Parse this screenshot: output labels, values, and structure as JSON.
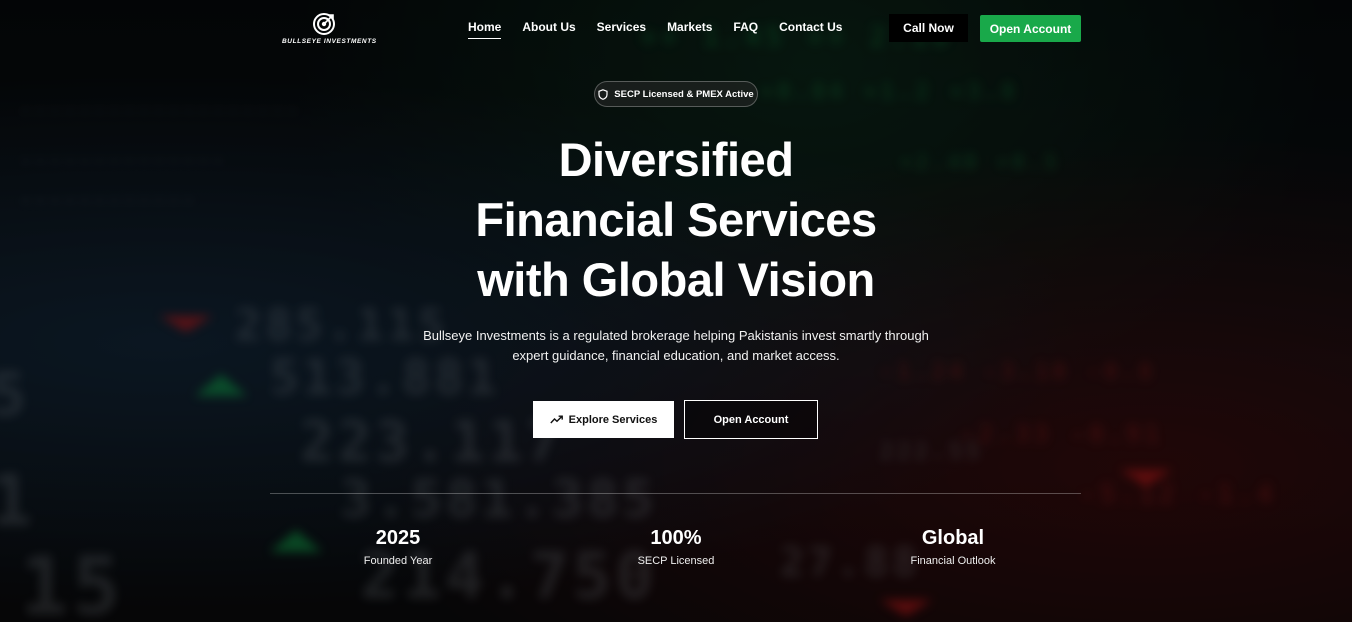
{
  "brand": {
    "name": "BULLSEYE INVESTMENTS",
    "logo_icon": "target-icon"
  },
  "nav": {
    "items": [
      {
        "label": "Home",
        "active": true
      },
      {
        "label": "About Us",
        "active": false
      },
      {
        "label": "Services",
        "active": false
      },
      {
        "label": "Markets",
        "active": false
      },
      {
        "label": "FAQ",
        "active": false
      },
      {
        "label": "Contact Us",
        "active": false
      }
    ],
    "call_label": "Call Now",
    "open_account_label": "Open Account"
  },
  "badge": {
    "icon": "shield-icon",
    "text": "SECP Licensed & PMEX Active"
  },
  "hero": {
    "title_lines": [
      "Diversified",
      "Financial Services",
      "with Global Vision"
    ],
    "subtitle_lines": [
      "Bullseye Investments is a regulated brokerage helping Pakistanis invest smartly through",
      "expert guidance, financial education, and market access."
    ],
    "explore_label": "Explore Services",
    "explore_icon": "trending-up-icon",
    "open_account_label": "Open Account"
  },
  "stats": [
    {
      "value": "2025",
      "label": "Founded Year"
    },
    {
      "value": "100%",
      "label": "SECP Licensed"
    },
    {
      "value": "Global",
      "label": "Financial Outlook"
    }
  ],
  "colors": {
    "accent_green": "#19a94a",
    "background": "#050608",
    "text": "#ffffff"
  }
}
